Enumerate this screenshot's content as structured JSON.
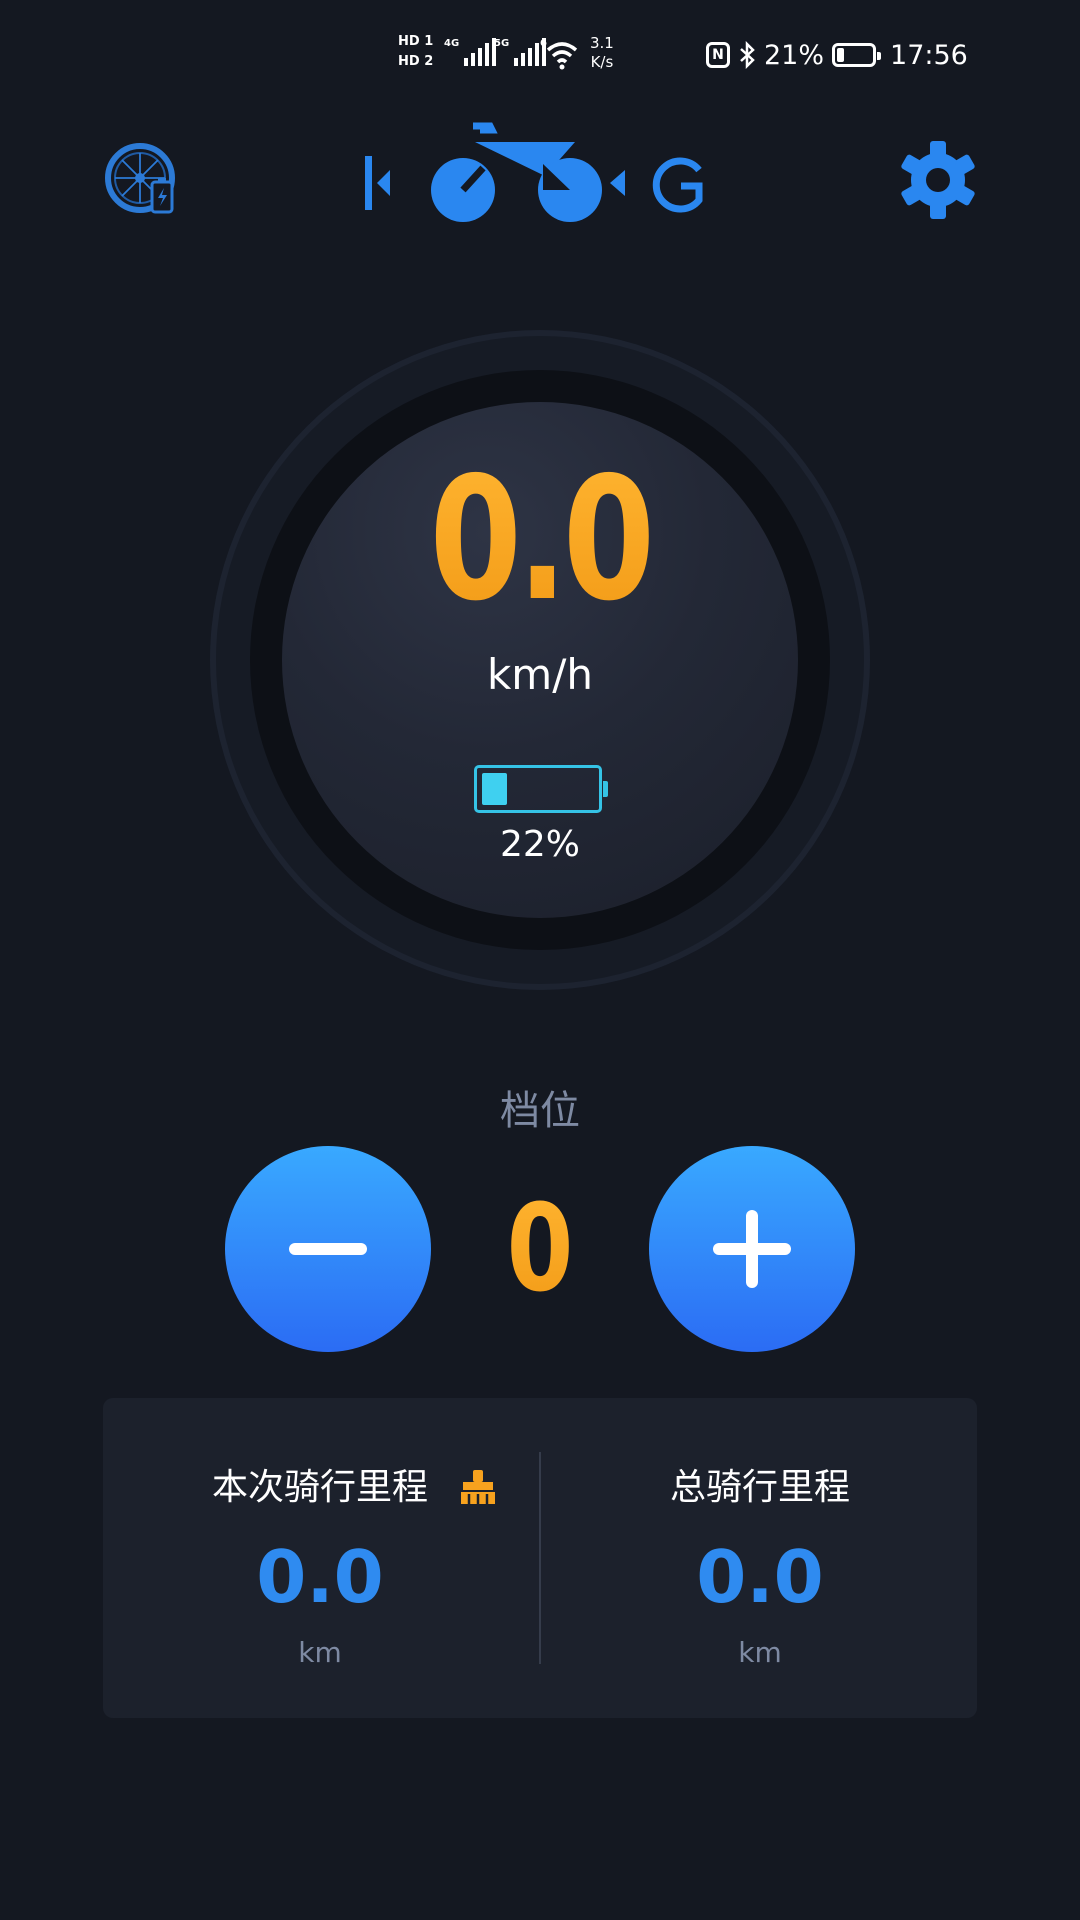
{
  "status_bar": {
    "hd1": "HD 1",
    "hd2": "HD 2",
    "net1": "4G",
    "net2": "5G",
    "wifi_label": "6",
    "speed_value": "3.1",
    "speed_unit": "K/s",
    "nfc": "N",
    "battery_percent": "21%",
    "battery_level": 0.21,
    "time": "17:56"
  },
  "header": {
    "left_icon": "wheel-battery-icon",
    "logo": "K-BIKE-G logo",
    "right_icon": "gear-settings-icon"
  },
  "gauge": {
    "speed": "0.0",
    "unit": "km/h",
    "battery_percent": "22%",
    "battery_level": 0.22
  },
  "gear": {
    "label": "档位",
    "value": "0",
    "minus_label": "−",
    "plus_label": "+"
  },
  "mileage": {
    "trip_title": "本次骑行里程",
    "trip_value": "0.0",
    "trip_unit": "km",
    "clear_icon": "broom-icon",
    "total_title": "总骑行里程",
    "total_value": "0.0",
    "total_unit": "km"
  },
  "colors": {
    "background": "#141821",
    "accent_orange": "#f7a21e",
    "accent_blue": "#2f8bf0",
    "battery_cyan": "#3fd0f0"
  }
}
